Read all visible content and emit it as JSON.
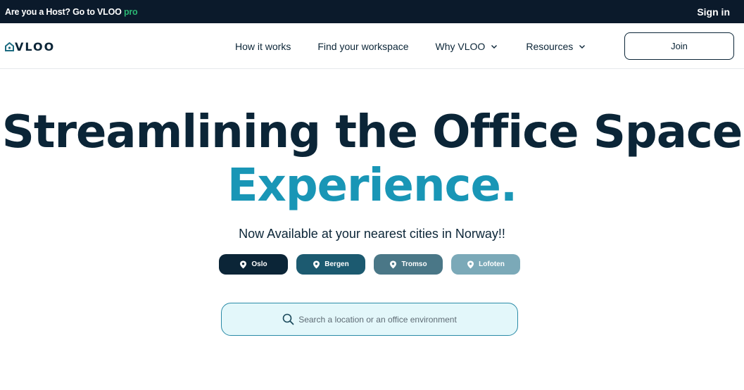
{
  "topbar": {
    "host_text": "Are you a Host? Go to VLOO",
    "host_pro": "pro",
    "signin": "Sign in"
  },
  "nav": {
    "logo_text": "VLOO",
    "links": [
      "How it works",
      "Find your workspace",
      "Why VLOO",
      "Resources"
    ],
    "join": "Join"
  },
  "hero": {
    "headline_line1": "Streamlining the Office Space",
    "headline_line2": "Experience.",
    "subtitle": "Now Available at your nearest cities in Norway!!"
  },
  "cities": [
    {
      "name": "Oslo",
      "color": "#0b2537"
    },
    {
      "name": "Bergen",
      "color": "#1c5a70"
    },
    {
      "name": "Tromso",
      "color": "#4a7787"
    },
    {
      "name": "Lofoten",
      "color": "#7ba9b8"
    }
  ],
  "search": {
    "placeholder": "Search a location or an office environment"
  },
  "colors": {
    "dark": "#0b2537",
    "accent": "#1996b6",
    "topbar_bg": "#0b1a2b",
    "pro": "#2bb673"
  }
}
